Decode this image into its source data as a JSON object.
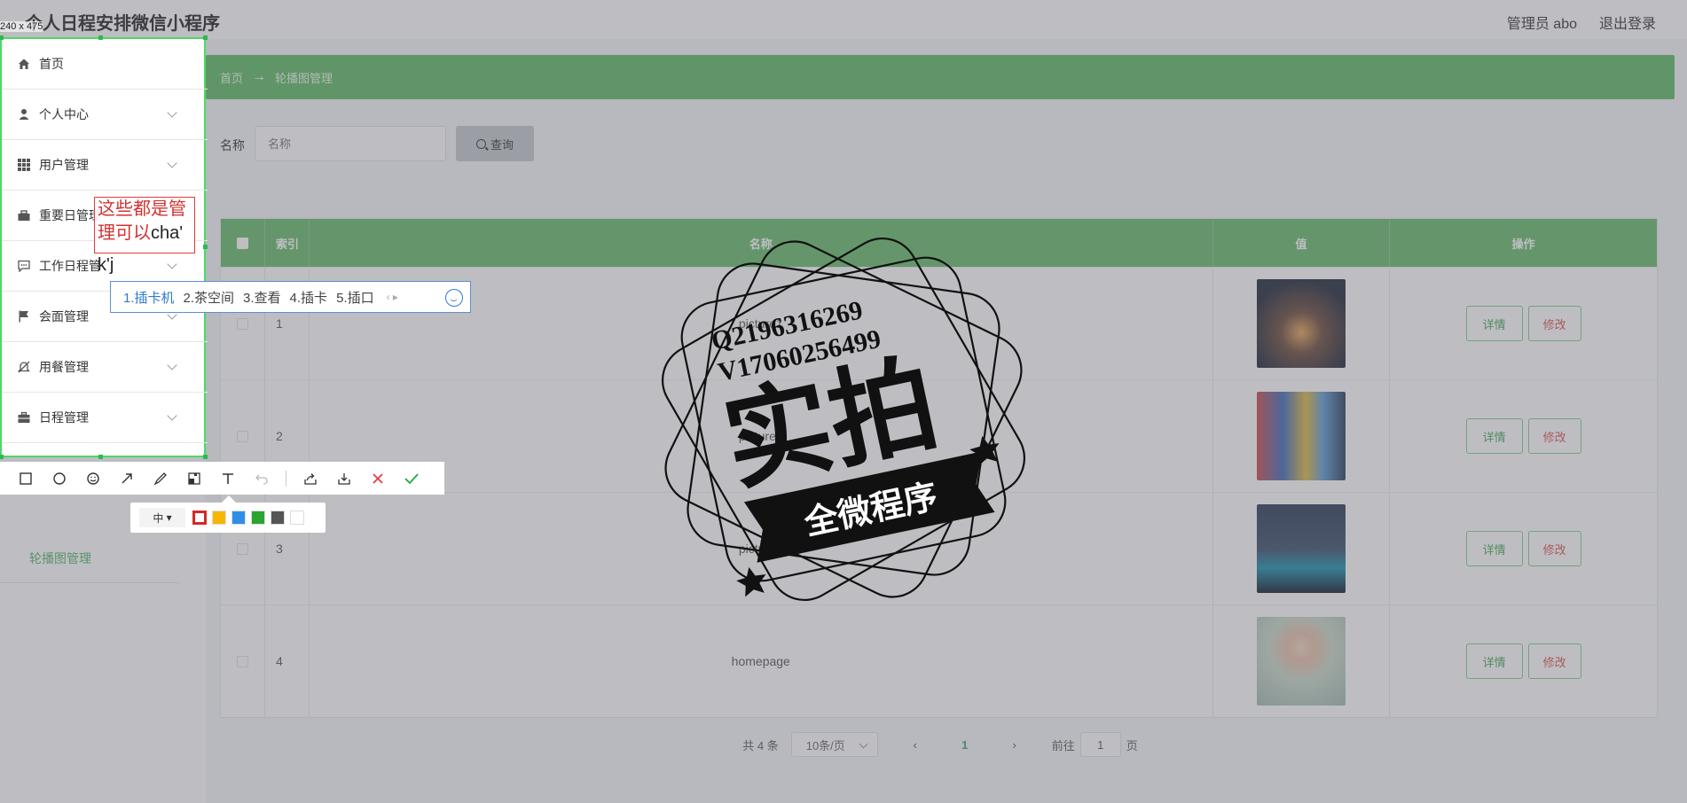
{
  "header": {
    "title": "个人日程安排微信小程序",
    "admin": "管理员 abo",
    "logout": "退出登录"
  },
  "sidebar": {
    "items": [
      {
        "label": "首页",
        "icon": "home-icon"
      },
      {
        "label": "个人中心",
        "icon": "user-icon"
      },
      {
        "label": "用户管理",
        "icon": "grid-icon"
      },
      {
        "label": "重要日管理",
        "icon": "briefcase-icon"
      },
      {
        "label": "工作日程管",
        "icon": "chat-icon"
      },
      {
        "label": "会面管理",
        "icon": "flag-icon"
      },
      {
        "label": "用餐管理",
        "icon": "bell-off-icon"
      },
      {
        "label": "日程管理",
        "icon": "suitcase-icon"
      }
    ],
    "sub_item": "轮播图管理"
  },
  "breadcrumb": {
    "home": "首页",
    "arrow": "→",
    "current": "轮播图管理"
  },
  "search": {
    "label": "名称",
    "placeholder": "名称",
    "button": "查询"
  },
  "table": {
    "headers": {
      "index": "索引",
      "name": "名称",
      "value": "值",
      "ops": "操作"
    },
    "rows": [
      {
        "index": "1",
        "name": "picture1"
      },
      {
        "index": "2",
        "name": "picture2"
      },
      {
        "index": "3",
        "name": "picture3"
      },
      {
        "index": "4",
        "name": "homepage"
      }
    ],
    "detail_label": "详情",
    "edit_label": "修改"
  },
  "pagination": {
    "total": "共 4 条",
    "page_size": "10条/页",
    "current": "1",
    "goto_prefix": "前往",
    "goto_value": "1",
    "goto_suffix": "页"
  },
  "screenshot_tool": {
    "selection_size": "240 x 475",
    "annotation_text": "这些都是管理可以",
    "annotation_typing": "cha'",
    "annotation_tail": "k'j",
    "ime_candidates": [
      "1.插卡机",
      "2.茶空间",
      "3.查看",
      "4.插卡",
      "5.插口"
    ],
    "font_size": "中",
    "colors": [
      "#d62828",
      "#f5b700",
      "#2f8fe8",
      "#2aa630",
      "#555555",
      "#ffffff"
    ]
  },
  "watermark": {
    "line1": "Q2196316269",
    "line2": "V17060256499",
    "main": "实拍",
    "banner": "全微程序"
  }
}
